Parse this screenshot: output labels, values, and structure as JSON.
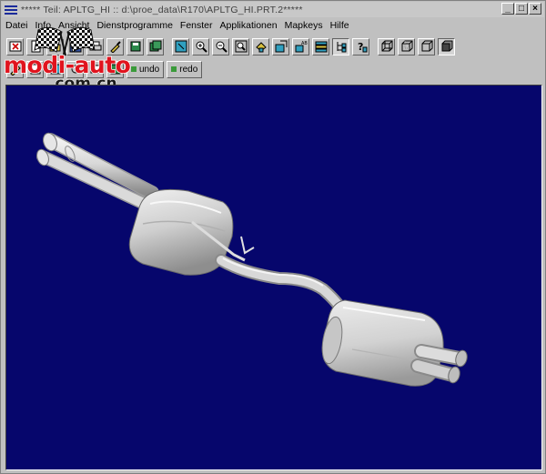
{
  "window": {
    "title": "***** Teil: APLTG_HI :: d:\\proe_data\\R170\\APLTG_HI.PRT.2*****",
    "controls": {
      "minimize": "_",
      "maximize": "□",
      "close": "×"
    }
  },
  "menu": {
    "items": [
      "Datei",
      "Info",
      "Ansicht",
      "Dienstprogramme",
      "Fenster",
      "Applikationen",
      "Mapkeys",
      "Hilfe"
    ]
  },
  "toolbar": {
    "row1_icons": [
      "close-window-icon",
      "new-file-icon",
      "open-file-icon",
      "save-icon",
      "print-icon",
      "repaint-icon",
      "save-copy-icon",
      "save-as-icon",
      "refit-icon",
      "zoom-in-icon",
      "zoom-out-icon",
      "zoom-window-icon",
      "orient-icon",
      "datum-planes-icon",
      "datum-axes-icon",
      "layers-icon",
      "model-tree-icon",
      "help-icon",
      "wireframe-icon",
      "hidden-line-icon",
      "no-hidden-icon",
      "shading-icon"
    ],
    "undo_label": "undo",
    "redo_label": "redo"
  },
  "watermark": {
    "brand": "modi-auto",
    "domain": ".com.cn"
  },
  "viewport": {
    "background_color": "#06066c",
    "model_color": "#d4d4d4",
    "model": "exhaust-muffler-assembly"
  },
  "colors": {
    "chrome": "#c0c0c0",
    "titlebar": "#c8c8c8",
    "watermark_red": "#e0141e"
  }
}
